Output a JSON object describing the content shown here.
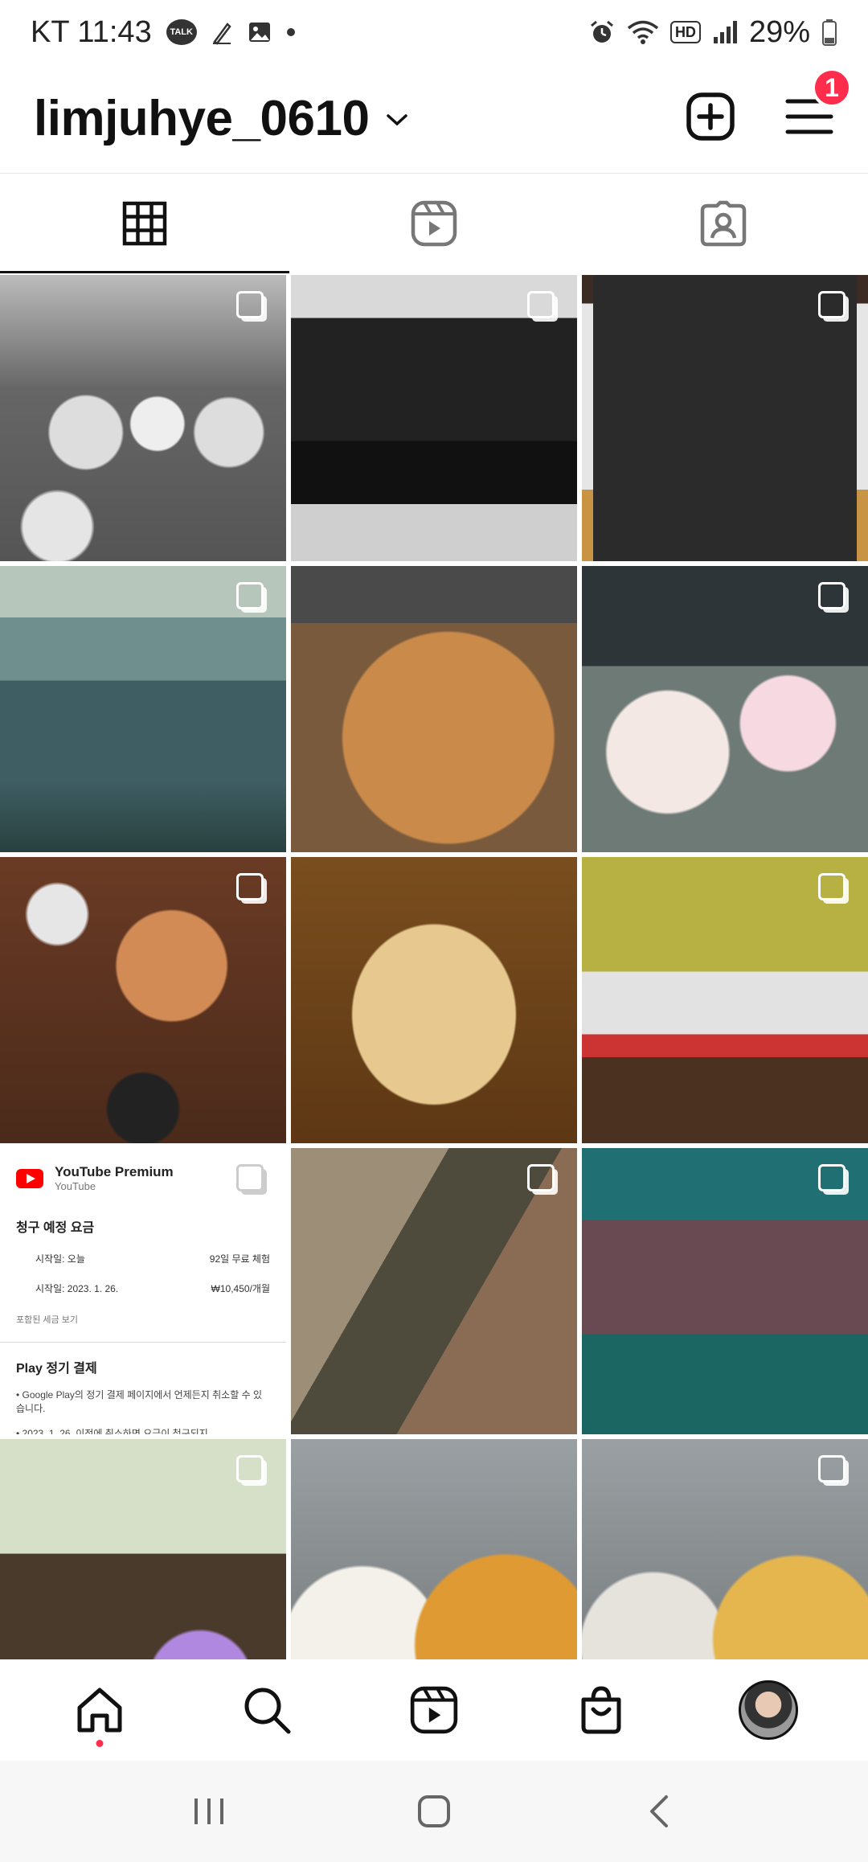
{
  "status_bar": {
    "carrier_time": "KT 11:43",
    "talk_label": "TALK",
    "hd_label": "HD",
    "battery": "29%"
  },
  "header": {
    "username": "limjuhye_0610",
    "notification_count": "1"
  },
  "tabs": [
    {
      "name": "posts",
      "icon": "grid-icon",
      "active": true
    },
    {
      "name": "reels",
      "icon": "reels-icon",
      "active": false
    },
    {
      "name": "tagged",
      "icon": "tagged-icon",
      "active": false
    }
  ],
  "youtube_card": {
    "title": "YouTube Premium",
    "subtitle": "YouTube",
    "section_title": "청구 예정 요금",
    "start_today_label": "시작일: 오늘",
    "trial_text": "92일 무료 체험",
    "start_date_label": "시작일: 2023. 1. 26.",
    "price_text": "₩10,450/개월",
    "tax_note": "포함된 세금 보기",
    "play_title": "Play 정기 결제",
    "note_1": "• Google Play의 정기 결제 페이지에서 언제든지 취소할 수 있습니다.",
    "note_2": "• 2023. 1. 26. 이전에 취소하면 요금이 청구되지"
  },
  "colors": {
    "accent_red": "#ff2d4b",
    "youtube_red": "#ff0000"
  }
}
